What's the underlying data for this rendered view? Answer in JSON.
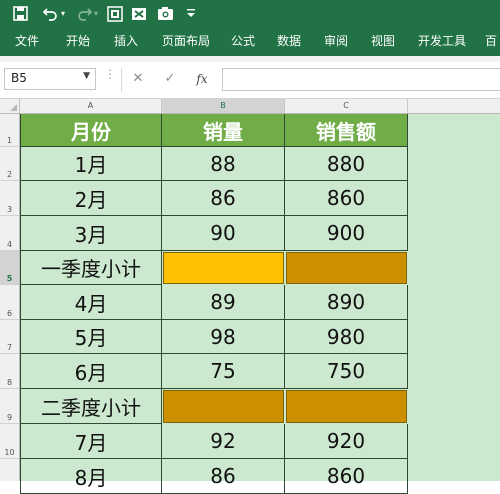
{
  "window": {
    "accent_color": "#217346",
    "quick_access_icons": [
      "save-icon",
      "undo-icon",
      "undo-dropdown-icon",
      "redo-icon",
      "redo-dropdown-icon",
      "screenshot-tool-icon",
      "delete-image-icon",
      "camera-icon",
      "customize-qat-icon"
    ]
  },
  "ribbon": {
    "tabs": [
      "文件",
      "开始",
      "插入",
      "页面布局",
      "公式",
      "数据",
      "审阅",
      "视图",
      "开发工具",
      "百"
    ]
  },
  "formula_bar": {
    "name_box": "B5",
    "fx_label": "fx",
    "cancel_icon": "cancel-icon",
    "enter_icon": "check-icon",
    "formula_value": ""
  },
  "grid": {
    "column_letters": [
      "A",
      "B",
      "C"
    ],
    "row_numbers": [
      "1",
      "2",
      "3",
      "4",
      "5",
      "6",
      "7",
      "8",
      "9",
      "10"
    ],
    "selected_row": "5",
    "selected_cell": "B5",
    "header": [
      "月份",
      "销量",
      "销售额"
    ],
    "rows": [
      [
        "1月",
        "88",
        "880"
      ],
      [
        "2月",
        "86",
        "860"
      ],
      [
        "3月",
        "90",
        "900"
      ],
      [
        "一季度小计",
        "",
        ""
      ],
      [
        "4月",
        "89",
        "890"
      ],
      [
        "5月",
        "98",
        "980"
      ],
      [
        "6月",
        "75",
        "750"
      ],
      [
        "二季度小计",
        "",
        ""
      ],
      [
        "7月",
        "92",
        "920"
      ],
      [
        "8月",
        "86",
        "860"
      ]
    ],
    "colors": {
      "sheet_background": "#cce8cf",
      "header_fill": "#70ad47",
      "selected_fill": "#ffc000",
      "subtotal_fill": "#cc8f00"
    }
  }
}
